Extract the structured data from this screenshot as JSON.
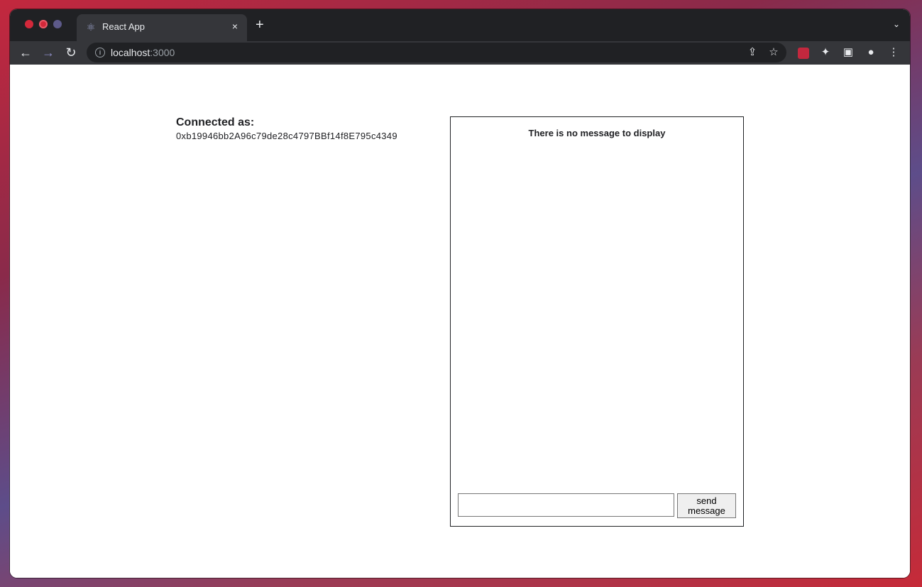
{
  "browser": {
    "tab_title": "React App",
    "tab_close": "×",
    "new_tab": "+",
    "tab_menu": "⌄",
    "url_host": "localhost",
    "url_port": ":3000",
    "icons": {
      "back": "←",
      "forward": "→",
      "reload": "↻",
      "share": "⇪",
      "bookmark": "☆",
      "extensions": "✦",
      "sidepanel": "▣",
      "profile": "●",
      "menu": "⋮",
      "info": "i",
      "favicon": "⚛"
    }
  },
  "page": {
    "connected_label": "Connected as:",
    "connected_address": "0xb19946bb2A96c79de28c4797BBf14f8E795c4349",
    "empty_message": "There is no message to display",
    "message_input_value": "",
    "send_button_label": "send message"
  }
}
